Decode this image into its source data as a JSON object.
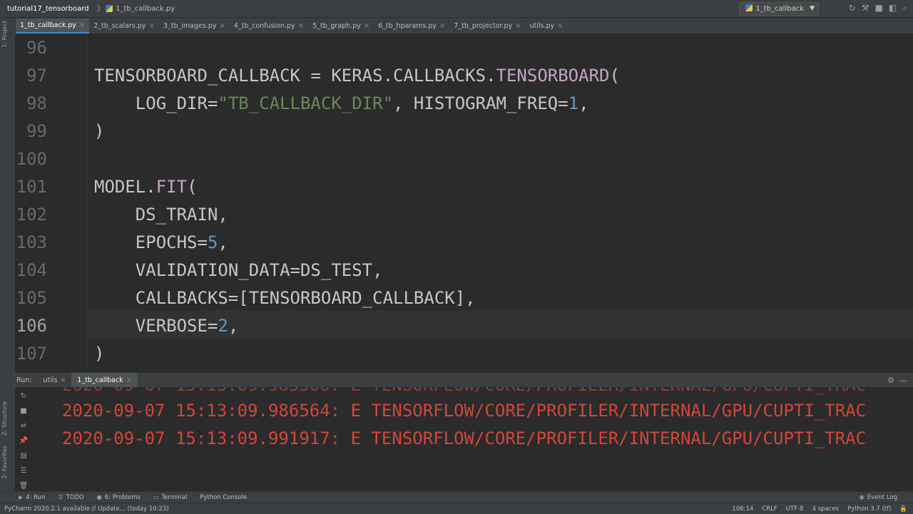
{
  "navbar": {
    "project": "tutorial17_tensorboard",
    "file": "1_tb_callback.py",
    "run_config": "1_tb_callback"
  },
  "tabs": [
    {
      "label": "1_tb_callback.py"
    },
    {
      "label": "2_tb_scalars.py"
    },
    {
      "label": "3_tb_images.py"
    },
    {
      "label": "4_tb_confusion.py"
    },
    {
      "label": "5_tb_graph.py"
    },
    {
      "label": "6_tb_hparams.py"
    },
    {
      "label": "7_tb_projector.py"
    },
    {
      "label": "utils.py"
    }
  ],
  "left_strip": {
    "project": "1: Project",
    "structure": "Z: Structure",
    "favorites": "2: Favorites"
  },
  "editor": {
    "lines": [
      {
        "num": "96"
      },
      {
        "num": "97"
      },
      {
        "num": "98"
      },
      {
        "num": "99"
      },
      {
        "num": "100"
      },
      {
        "num": "101"
      },
      {
        "num": "102"
      },
      {
        "num": "103"
      },
      {
        "num": "104"
      },
      {
        "num": "105"
      },
      {
        "num": "106"
      },
      {
        "num": "107"
      }
    ],
    "code": {
      "l97_a": "TENSORBOARD_CALLBACK = KERAS.CALLBACKS.",
      "l97_b": "TENSORBOARD",
      "l97_c": "(",
      "l98_a": "    LOG_DIR=",
      "l98_b": "\"TB_CALLBACK_DIR\"",
      "l98_c": ", HISTOGRAM_FREQ=",
      "l98_d": "1",
      "l98_e": ",",
      "l99": ")",
      "l101_a": "MODEL.",
      "l101_b": "FIT",
      "l101_c": "(",
      "l102": "    DS_TRAIN,",
      "l103_a": "    EPOCHS=",
      "l103_b": "5",
      "l103_c": ",",
      "l104": "    VALIDATION_DATA=DS_TEST,",
      "l105": "    CALLBACKS=[TENSORBOARD_CALLBACK],",
      "l106_a": "    VERBOSE=",
      "l106_b": "2",
      "l106_c": ",",
      "l107": ")"
    }
  },
  "run": {
    "label": "Run:",
    "tabs": [
      {
        "label": "utils"
      },
      {
        "label": "1_tb_callback"
      }
    ],
    "log_lines": [
      "2020-09-07 15:13:09.986564: E TENSORFLOW/CORE/PROFILER/INTERNAL/GPU/CUPTI_TRAC",
      "2020-09-07 15:13:09.991917: E TENSORFLOW/CORE/PROFILER/INTERNAL/GPU/CUPTI_TRAC"
    ]
  },
  "toolbar": {
    "run": "4: Run",
    "todo": "TODO",
    "problems": "6: Problems",
    "terminal": "Terminal",
    "python_console": "Python Console",
    "event_log": "Event Log"
  },
  "status": {
    "message": "PyCharm 2020.2.1 available // Update... (today 10:23)",
    "position": "106:14",
    "line_sep": "CRLF",
    "encoding": "UTF-8",
    "indent": "4 spaces",
    "interpreter": "Python 3.7 (tf)"
  }
}
